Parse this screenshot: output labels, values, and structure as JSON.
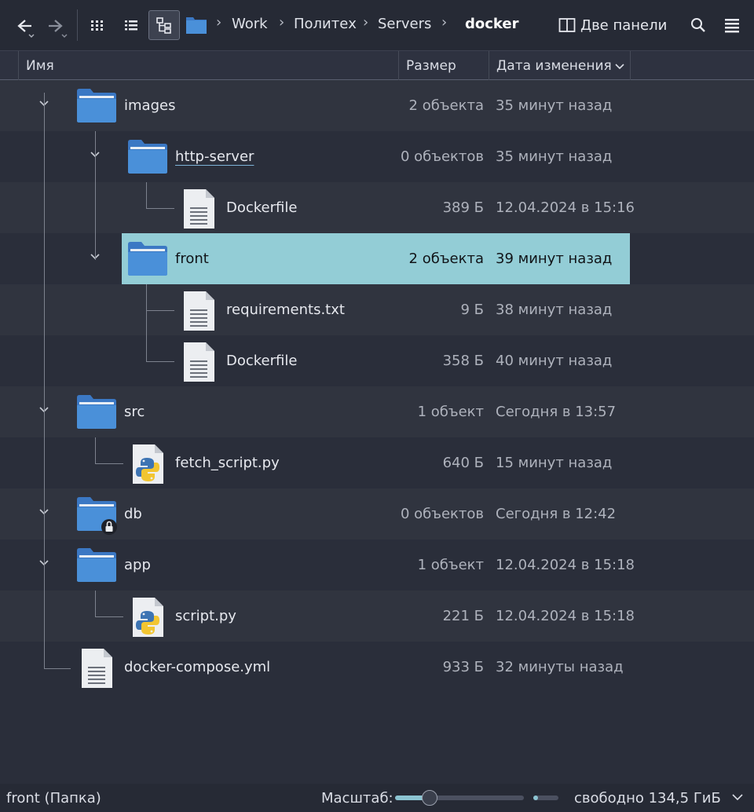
{
  "toolbar": {
    "breadcrumbs": [
      "Work",
      "Политех",
      "Servers"
    ],
    "current": "docker",
    "dual_panel_label": "Две панели"
  },
  "columns": {
    "name": "Имя",
    "size": "Размер",
    "modified": "Дата изменения"
  },
  "files": [
    {
      "name": "images",
      "size": "2 объекта",
      "modified": "35 минут назад",
      "type": "folder"
    },
    {
      "name": "http-server",
      "size": "0 объектов",
      "modified": "35 минут назад",
      "type": "folder"
    },
    {
      "name": "Dockerfile",
      "size": "389 Б",
      "modified": "12.04.2024 в 15:16",
      "type": "text"
    },
    {
      "name": "front",
      "size": "2 объекта",
      "modified": "39 минут назад",
      "type": "folder",
      "selected": true
    },
    {
      "name": "requirements.txt",
      "size": "9 Б",
      "modified": "38 минут назад",
      "type": "text"
    },
    {
      "name": "Dockerfile",
      "size": "358 Б",
      "modified": "40 минут назад",
      "type": "text"
    },
    {
      "name": "src",
      "size": "1 объект",
      "modified": "Сегодня в 13:57",
      "type": "folder"
    },
    {
      "name": "fetch_script.py",
      "size": "640 Б",
      "modified": "15 минут назад",
      "type": "python"
    },
    {
      "name": "db",
      "size": "0 объектов",
      "modified": "Сегодня в 12:42",
      "type": "folder-locked"
    },
    {
      "name": "app",
      "size": "1 объект",
      "modified": "12.04.2024 в 15:18",
      "type": "folder"
    },
    {
      "name": "script.py",
      "size": "221 Б",
      "modified": "12.04.2024 в 15:18",
      "type": "python"
    },
    {
      "name": "docker-compose.yml",
      "size": "933 Б",
      "modified": "32 минуты назад",
      "type": "text"
    }
  ],
  "status": {
    "selection": "front (Папка)",
    "zoom_label": "Масштаб:",
    "zoom_level": 0.27,
    "free_space": "свободно 134,5 ГиБ",
    "free_space_fraction": 0.2
  },
  "colors": {
    "selection": "#93cdd6",
    "folder": "#4a90d9",
    "background": "#2a2e3a"
  }
}
